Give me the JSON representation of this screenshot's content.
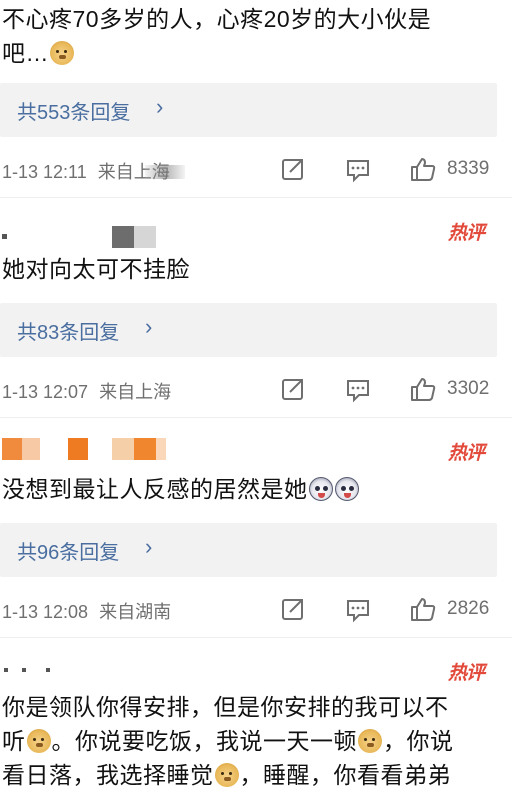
{
  "comments": [
    {
      "text_line1": "不心疼70多岁的人，心疼20岁的大小伙是",
      "text_line2": "吧…",
      "replies_label": "共553条回复",
      "date": "1-13 12:11",
      "source": "来自上海",
      "likes": "8339"
    },
    {
      "hot_label": "热评",
      "text_line1": "她对向太可不挂脸",
      "replies_label": "共83条回复",
      "date": "1-13 12:07",
      "source": "来自上海",
      "likes": "3302"
    },
    {
      "hot_label": "热评",
      "text_line1": "没想到最让人反感的居然是她",
      "replies_label": "共96条回复",
      "date": "1-13 12:08",
      "source": "来自湖南",
      "likes": "2826"
    },
    {
      "hot_label": "热评",
      "text_line1a": "你是领队你得安排，但是你安排的我可以不",
      "text_line2a": "听",
      "text_line2b": "。你说要吃饭，我说一天一顿",
      "text_line2c": "，你说",
      "text_line3a": "看日落，我选择睡觉",
      "text_line3b": "，睡醒，你看看弟弟"
    }
  ],
  "arrow_glyph": "›",
  "icons": {
    "share": "share-icon",
    "comment": "comment-icon",
    "like": "thumbs-up-icon",
    "emoji_doge": "doge-emoji-icon",
    "emoji_husky": "husky-emoji-icon"
  },
  "colors": {
    "link": "#4a6ea0",
    "meta": "#6f6f6f",
    "hot": "#e24a3b",
    "reply_bg": "#f2f2f2"
  }
}
